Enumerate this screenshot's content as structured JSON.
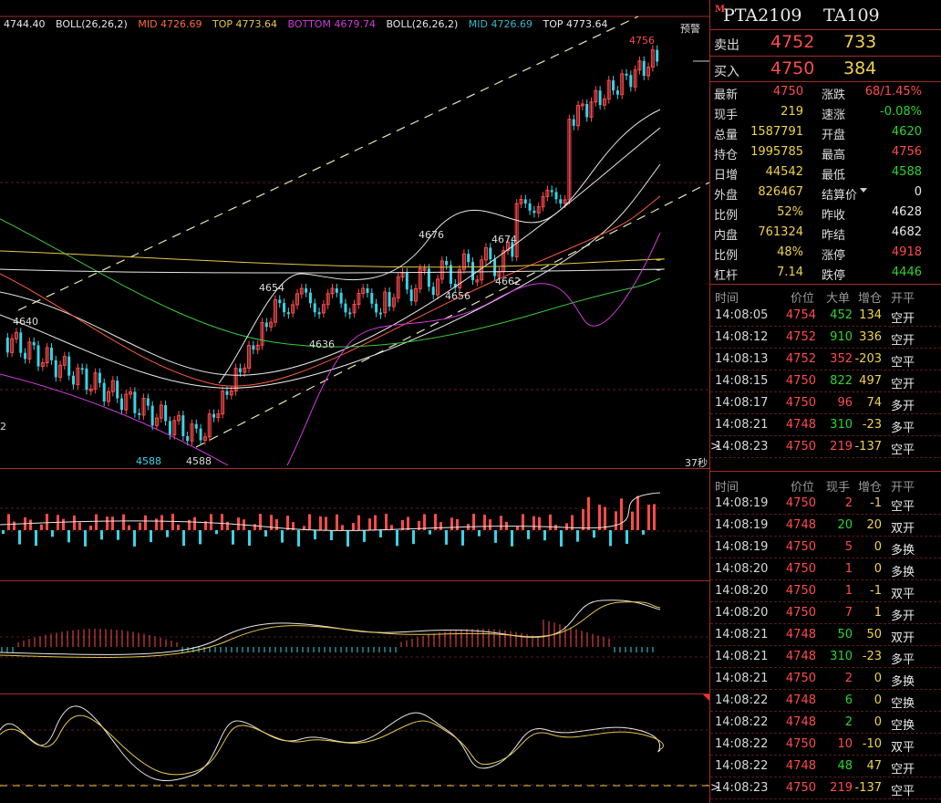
{
  "boll_header": [
    {
      "text": "4744.40",
      "color": "#e8e8e8"
    },
    {
      "text": "BOLL(26,26,2)",
      "color": "#e8e8e8"
    },
    {
      "text": "MID 4726.69",
      "color": "#ff6a3a"
    },
    {
      "text": "TOP 4773.64",
      "color": "#e6c84a"
    },
    {
      "text": "BOTTOM 4679.74",
      "color": "#d23adb"
    },
    {
      "text": "BOLL(26,26,2)",
      "color": "#e8e8e8"
    },
    {
      "text": "MID 4726.69",
      "color": "#3ab6c8"
    },
    {
      "text": "TOP 4773.64",
      "color": "#e8e8e8"
    }
  ],
  "annotations": {
    "warning_label": "预警",
    "high_4756": "4756",
    "p4676": "4676",
    "p4674": "4674",
    "p4656": "4656",
    "p4662": "4662",
    "p4654": "4654",
    "p4636": "4636",
    "p4640": "4640",
    "p4588a": "4588",
    "p4588b": "4588",
    "left_edge_2": "2",
    "countdown": "37秒"
  },
  "header": {
    "badge": "M",
    "contract": "PTA2109",
    "code": "TA109"
  },
  "quotes": {
    "ask_label": "卖出",
    "ask_price": "4752",
    "ask_vol": "733",
    "bid_label": "买入",
    "bid_price": "4750",
    "bid_vol": "384"
  },
  "stats": [
    {
      "l1": "最新",
      "v1": "4750",
      "c1": "red",
      "l2": "涨跌",
      "v2": "68/1.45%",
      "c2": "red"
    },
    {
      "l1": "现手",
      "v1": "219",
      "c1": "yellow",
      "l2": "速涨",
      "v2": "-0.08%",
      "c2": "green"
    },
    {
      "l1": "总量",
      "v1": "1587791",
      "c1": "yellow",
      "l2": "开盘",
      "v2": "4620",
      "c2": "green"
    },
    {
      "l1": "持仓",
      "v1": "1995785",
      "c1": "yellow",
      "l2": "最高",
      "v2": "4756",
      "c2": "red"
    },
    {
      "l1": "日增",
      "v1": "44542",
      "c1": "yellow",
      "l2": "最低",
      "v2": "4588",
      "c2": "green"
    },
    {
      "l1": "外盘",
      "v1": "826467",
      "c1": "yellow",
      "l2": "结算价",
      "v2": "0",
      "c2": "white"
    },
    {
      "l1": "比例",
      "v1": "52%",
      "c1": "yellow",
      "l2": "昨收",
      "v2": "4628",
      "c2": "white"
    },
    {
      "l1": "内盘",
      "v1": "761324",
      "c1": "yellow",
      "l2": "昨结",
      "v2": "4682",
      "c2": "white"
    },
    {
      "l1": "比例",
      "v1": "48%",
      "c1": "yellow",
      "l2": "涨停",
      "v2": "4918",
      "c2": "red"
    },
    {
      "l1": "杠杆",
      "v1": "7.14",
      "c1": "yellow",
      "l2": "跌停",
      "v2": "4446",
      "c2": "green"
    }
  ],
  "table1": {
    "headers": [
      "时间",
      "价位",
      "大单",
      "增仓",
      "开平"
    ],
    "rows": [
      {
        "time": "14:08:05",
        "price": "4754",
        "pc": "red",
        "vol": "452",
        "vc": "green",
        "oi": "134",
        "oc": "yellow",
        "type": "空开"
      },
      {
        "time": "14:08:12",
        "price": "4752",
        "pc": "red",
        "vol": "910",
        "vc": "green",
        "oi": "336",
        "oc": "yellow",
        "type": "空开"
      },
      {
        "time": "14:08:13",
        "price": "4752",
        "pc": "red",
        "vol": "352",
        "vc": "red",
        "oi": "-203",
        "oc": "yellow",
        "type": "空平"
      },
      {
        "time": "14:08:15",
        "price": "4750",
        "pc": "red",
        "vol": "822",
        "vc": "green",
        "oi": "497",
        "oc": "yellow",
        "type": "空开"
      },
      {
        "time": "14:08:17",
        "price": "4750",
        "pc": "red",
        "vol": "96",
        "vc": "red",
        "oi": "74",
        "oc": "yellow",
        "type": "多开"
      },
      {
        "time": "14:08:21",
        "price": "4748",
        "pc": "red",
        "vol": "310",
        "vc": "green",
        "oi": "-23",
        "oc": "yellow",
        "type": "多平"
      },
      {
        "time": "14:08:23",
        "price": "4750",
        "pc": "red",
        "vol": "219",
        "vc": "red",
        "oi": "-137",
        "oc": "yellow",
        "type": "空平",
        "marker": ">"
      }
    ]
  },
  "table2": {
    "headers": [
      "时间",
      "价位",
      "现手",
      "增仓",
      "开平"
    ],
    "rows": [
      {
        "time": "14:08:19",
        "price": "4750",
        "vol": "2",
        "vc": "red",
        "oi": "-1",
        "type": "空平"
      },
      {
        "time": "14:08:19",
        "price": "4748",
        "vol": "20",
        "vc": "green",
        "oi": "20",
        "type": "双开"
      },
      {
        "time": "14:08:19",
        "price": "4750",
        "vol": "5",
        "vc": "red",
        "oi": "0",
        "type": "多换"
      },
      {
        "time": "14:08:20",
        "price": "4750",
        "vol": "1",
        "vc": "red",
        "oi": "0",
        "type": "多换"
      },
      {
        "time": "14:08:20",
        "price": "4750",
        "vol": "1",
        "vc": "red",
        "oi": "-1",
        "type": "双平"
      },
      {
        "time": "14:08:20",
        "price": "4750",
        "vol": "7",
        "vc": "red",
        "oi": "1",
        "type": "多开"
      },
      {
        "time": "14:08:21",
        "price": "4748",
        "vol": "50",
        "vc": "green",
        "oi": "50",
        "type": "双开"
      },
      {
        "time": "14:08:21",
        "price": "4748",
        "vol": "310",
        "vc": "green",
        "oi": "-23",
        "type": "多平"
      },
      {
        "time": "14:08:21",
        "price": "4750",
        "vol": "2",
        "vc": "red",
        "oi": "0",
        "type": "多换"
      },
      {
        "time": "14:08:22",
        "price": "4748",
        "vol": "6",
        "vc": "green",
        "oi": "0",
        "type": "空换"
      },
      {
        "time": "14:08:22",
        "price": "4748",
        "vol": "2",
        "vc": "green",
        "oi": "0",
        "type": "空换"
      },
      {
        "time": "14:08:22",
        "price": "4750",
        "vol": "10",
        "vc": "red",
        "oi": "-10",
        "type": "双平"
      },
      {
        "time": "14:08:22",
        "price": "4748",
        "vol": "48",
        "vc": "green",
        "oi": "47",
        "type": "空开"
      },
      {
        "time": "14:08:23",
        "price": "4750",
        "vol": "219",
        "vc": "red",
        "oi": "-137",
        "type": "空平",
        "marker": ">"
      }
    ]
  },
  "colors": {
    "up": "#ff4b4b",
    "down": "#3ad3e6",
    "border": "#a52a2a",
    "ma_white": "#e8e8e8",
    "ma_yellow": "#e6c84a",
    "ma_red": "#ff5a3a",
    "ma_green": "#3ac83a",
    "ma_magenta": "#d23adb",
    "trend": "#e6e6b0"
  }
}
